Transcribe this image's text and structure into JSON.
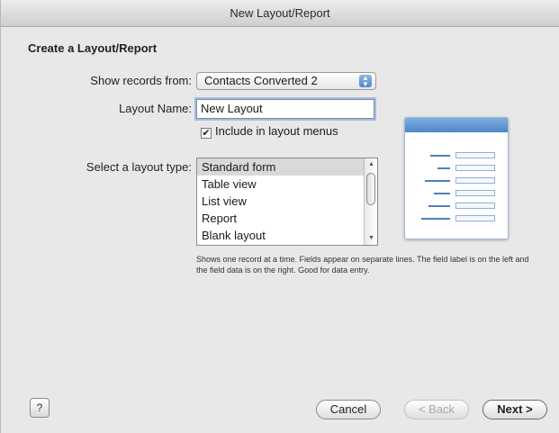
{
  "window": {
    "title": "New Layout/Report"
  },
  "section_title": "Create a Layout/Report",
  "form": {
    "show_records_label": "Show records from:",
    "show_records_value": "Contacts Converted 2",
    "layout_name_label": "Layout Name:",
    "layout_name_value": "New Layout",
    "include_menus_label": "Include in layout menus",
    "include_menus_checked": true,
    "layout_type_label": "Select a layout type:",
    "layout_types": [
      "Standard form",
      "Table view",
      "List view",
      "Report",
      "Blank layout"
    ],
    "selected_layout_type": "Standard form",
    "description": "Shows one record at a time. Fields appear on separate lines.  The field label is on the left and the field data is on the right.  Good for data entry."
  },
  "buttons": {
    "help": "?",
    "cancel": "Cancel",
    "back": "< Back",
    "next": "Next >"
  },
  "icons": {
    "popup": "up-down-arrows-icon",
    "checkbox": "checkmark-icon",
    "help": "question-icon"
  }
}
